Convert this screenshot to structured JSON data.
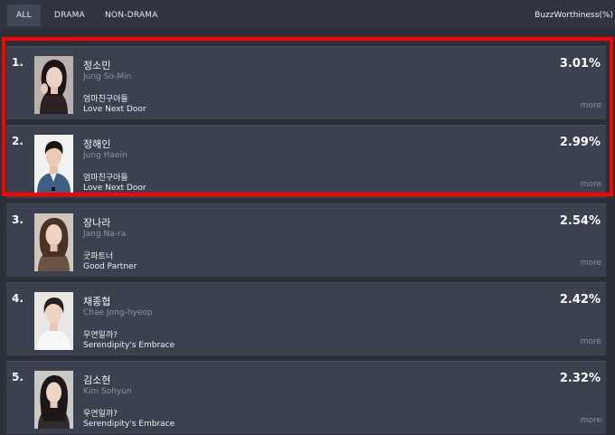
{
  "tabs": [
    {
      "label": "ALL",
      "active": true
    },
    {
      "label": "DRAMA",
      "active": false
    },
    {
      "label": "NON-DRAMA",
      "active": false
    }
  ],
  "buzz_label": "BuzzWorthiness(%)",
  "rows": [
    {
      "rank": "1.",
      "name_ko": "정소민",
      "name_en": "Jung So-Min",
      "show_ko": "엄마친구아들",
      "show_en": "Love Next Door",
      "percent": "3.01%",
      "more": "more"
    },
    {
      "rank": "2.",
      "name_ko": "정해인",
      "name_en": "Jung Haein",
      "show_ko": "엄마친구아들",
      "show_en": "Love Next Door",
      "percent": "2.99%",
      "more": "more"
    },
    {
      "rank": "3.",
      "name_ko": "장나라",
      "name_en": "Jang Na-ra",
      "show_ko": "굿파트너",
      "show_en": "Good Partner",
      "percent": "2.54%",
      "more": "more"
    },
    {
      "rank": "4.",
      "name_ko": "채종협",
      "name_en": "Chae Jong-hyeop",
      "show_ko": "우연일까?",
      "show_en": "Serendipity's Embrace",
      "percent": "2.42%",
      "more": "more"
    },
    {
      "rank": "5.",
      "name_ko": "김소현",
      "name_en": "Kim Sohyun",
      "show_ko": "우연일까?",
      "show_en": "Serendipity's Embrace",
      "percent": "2.32%",
      "more": "more"
    }
  ],
  "colors": {
    "background": "#2a2f38",
    "row_background": "#3c4150",
    "highlight_border": "#ff0000",
    "muted_text": "#8d93a2"
  }
}
